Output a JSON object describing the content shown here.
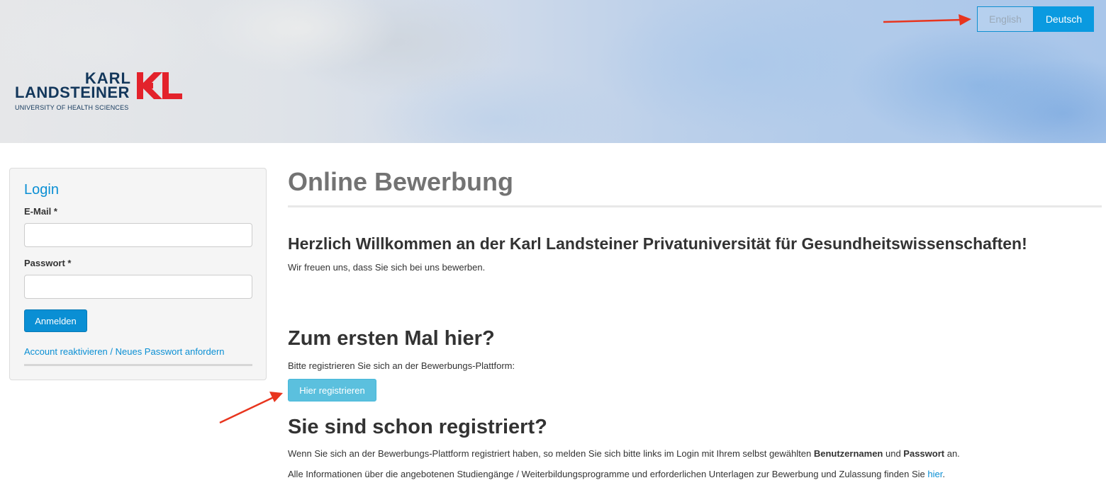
{
  "header": {
    "languages": [
      {
        "label": "English",
        "active": false
      },
      {
        "label": "Deutsch",
        "active": true
      }
    ],
    "logo": {
      "line1": "KARL",
      "line2": "LANDSTEINER",
      "subtitle": "UNIVERSITY OF HEALTH SCIENCES",
      "mark": "KL"
    }
  },
  "login": {
    "title": "Login",
    "email_label": "E-Mail *",
    "email_value": "",
    "password_label": "Passwort *",
    "password_value": "",
    "submit_label": "Anmelden",
    "reactivate_link": "Account reaktivieren / Neues Passwort anfordern"
  },
  "main": {
    "page_title": "Online Bewerbung",
    "welcome_heading": "Herzlich Willkommen an der Karl Landsteiner Privatuniversität für Gesundheitswissenschaften!",
    "welcome_text": "Wir freuen uns, dass Sie sich bei uns bewerben.",
    "first_time_heading": "Zum ersten Mal hier?",
    "first_time_text": "Bitte registrieren Sie sich an der Bewerbungs-Plattform:",
    "register_label": "Hier registrieren",
    "registered_heading": "Sie sind schon registriert?",
    "registered_text": {
      "part1": "Wenn Sie sich an der Bewerbungs-Plattform registriert haben, so melden Sie sich bitte links im Login mit Ihrem selbst gewählten ",
      "bold1": "Benutzernamen",
      "part2": " und ",
      "bold2": "Passwort",
      "part3": " an."
    },
    "info_text": {
      "part1": "Alle Informationen über die angebotenen Studiengänge / Weiterbildungsprogramme und erforderlichen Unterlagen zur Bewerbung und Zulassung finden Sie ",
      "link": "hier",
      "part2": "."
    }
  },
  "colors": {
    "accent": "#0a8fd4",
    "register": "#5bc0de",
    "logo_navy": "#13375b",
    "logo_red": "#e3222b",
    "annotation_arrow": "#e8351e"
  }
}
